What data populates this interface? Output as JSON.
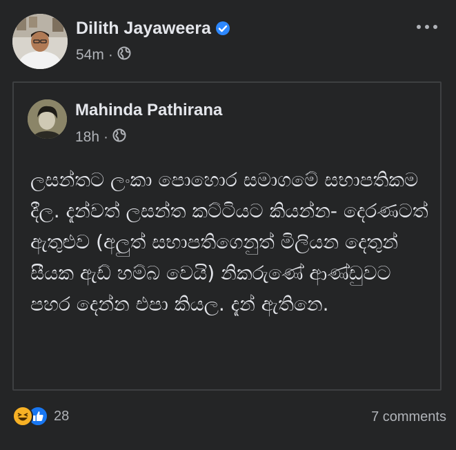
{
  "post": {
    "author": {
      "name": "Dilith Jayaweera",
      "verified": true,
      "time": "54m",
      "audience_icon": "globe-icon"
    },
    "more_icon": "more-options-icon",
    "shared_post": {
      "author": {
        "name": "Mahinda Pathirana",
        "time": "18h",
        "audience_icon": "globe-icon"
      },
      "text": "ලසන්තට ලංකා පොහොර සමාගමේ සභාපතිකම දීල. දැන්වත් ලසන්ත කට්ටියට කියන්න- දෙරණටත් ඇතුළුව (අලුත් සභාපතිගෙනුත් මිලියන දෙතුන් සීයක ඇඩ් හම්බ වෙයි) නිකරුණේ ආණ්ඩුවට පහර දෙන්න එපා කියල. දැන් ඇතිනෙ."
    },
    "reactions": {
      "icons": [
        "haha-reaction-icon",
        "like-reaction-icon"
      ],
      "count": "28"
    },
    "comments_label": "7 comments",
    "colors": {
      "background": "#242526",
      "text_primary": "#e4e6eb",
      "text_secondary": "#b0b3b8",
      "verified_blue": "#2d88ff",
      "like_blue": "#1877f2",
      "haha_yellow": "#f7b125"
    }
  }
}
